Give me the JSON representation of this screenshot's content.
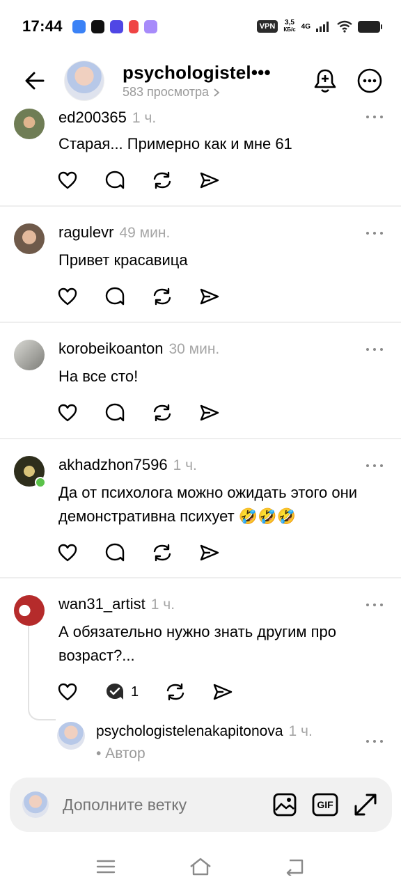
{
  "status_bar": {
    "time": "17:44",
    "vpn": "VPN",
    "speed_value": "3,5",
    "speed_unit": "КБ/с",
    "network": "4G",
    "app_colors": [
      "#3b82f6",
      "#111111",
      "#4f46e5",
      "#ef4444",
      "#a78bfa"
    ]
  },
  "header": {
    "title": "psychologistel•••",
    "subtitle": "583 просмотра",
    "icons": [
      "arrow-left",
      "bell-plus",
      "more-horizontal"
    ]
  },
  "comments": [
    {
      "author": "ed200365",
      "time": "1 ч.",
      "text": "Старая... Примерно как и мне 61",
      "avatar_color": "#6f7d55"
    },
    {
      "author": "ragulevr",
      "time": "49 мин.",
      "text": "Привет красавица",
      "avatar_color": "#d5b39a"
    },
    {
      "author": "korobeikoanton",
      "time": "30 мин.",
      "text": "На все сто!",
      "avatar_color": "#9a9a94"
    },
    {
      "author": "akhadzhon7596",
      "time": "1 ч.",
      "text": "Да от психолога можно ожидать этого они демонстративна психует 🤣🤣🤣",
      "avatar_color": "#4a4a2e",
      "online": true
    },
    {
      "author": "wan31_artist",
      "time": "1 ч.",
      "text": "А обязательно нужно знать другим про возраст?...",
      "avatar_color": "#b52b2b",
      "reply_count": "1"
    }
  ],
  "reply": {
    "author": "psychologistelenakapitonova",
    "time": "1 ч.",
    "role": "• Автор"
  },
  "input": {
    "placeholder": "Дополните ветку",
    "gif_label": "GIF"
  }
}
